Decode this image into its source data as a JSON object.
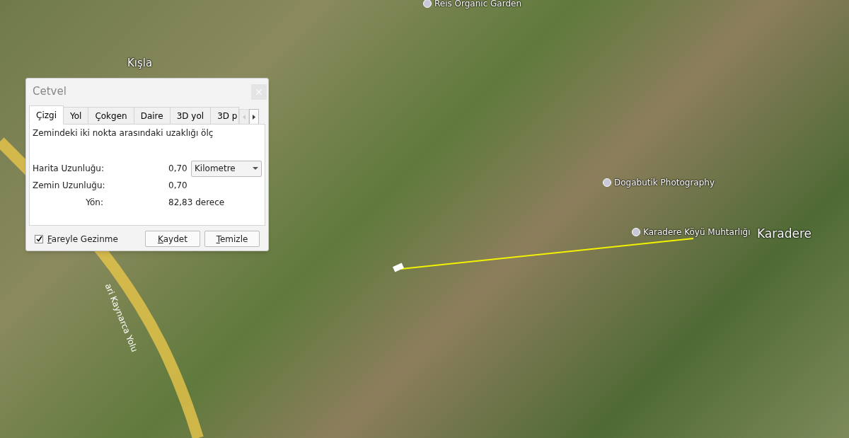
{
  "map": {
    "labels": [
      {
        "text": "Reis Organic Garden",
        "kind": "poi"
      },
      {
        "text": "Kışla",
        "kind": "place"
      },
      {
        "text": "Dogabutik Photography",
        "kind": "poi"
      },
      {
        "text": "Karadere Köyü Muhtarlığı",
        "kind": "poi"
      },
      {
        "text": "Karadere",
        "kind": "town"
      },
      {
        "text": "ari Kaynarca Yolu",
        "kind": "road"
      }
    ]
  },
  "ruler": {
    "title": "Cetvel",
    "tabs": [
      {
        "label": "Çizgi",
        "selected": true
      },
      {
        "label": "Yol",
        "selected": false
      },
      {
        "label": "Çokgen",
        "selected": false
      },
      {
        "label": "Daire",
        "selected": false
      },
      {
        "label": "3D yol",
        "selected": false
      },
      {
        "label": "3D p",
        "selected": false
      }
    ],
    "description": "Zemindeki iki nokta arasındaki uzaklığı ölç",
    "rows": [
      {
        "label": "Harita Uzunluğu:",
        "value": "0,70",
        "unit_select": "Kilometre"
      },
      {
        "label": "Zemin Uzunluğu:",
        "value": "0,70"
      },
      {
        "label": "Yön:",
        "value": "82,83 derece"
      }
    ],
    "checkbox": {
      "label": "Fareyle Gezinme",
      "checked": true
    },
    "buttons": [
      {
        "label": "Kaydet"
      },
      {
        "label": "Temizle"
      }
    ]
  }
}
